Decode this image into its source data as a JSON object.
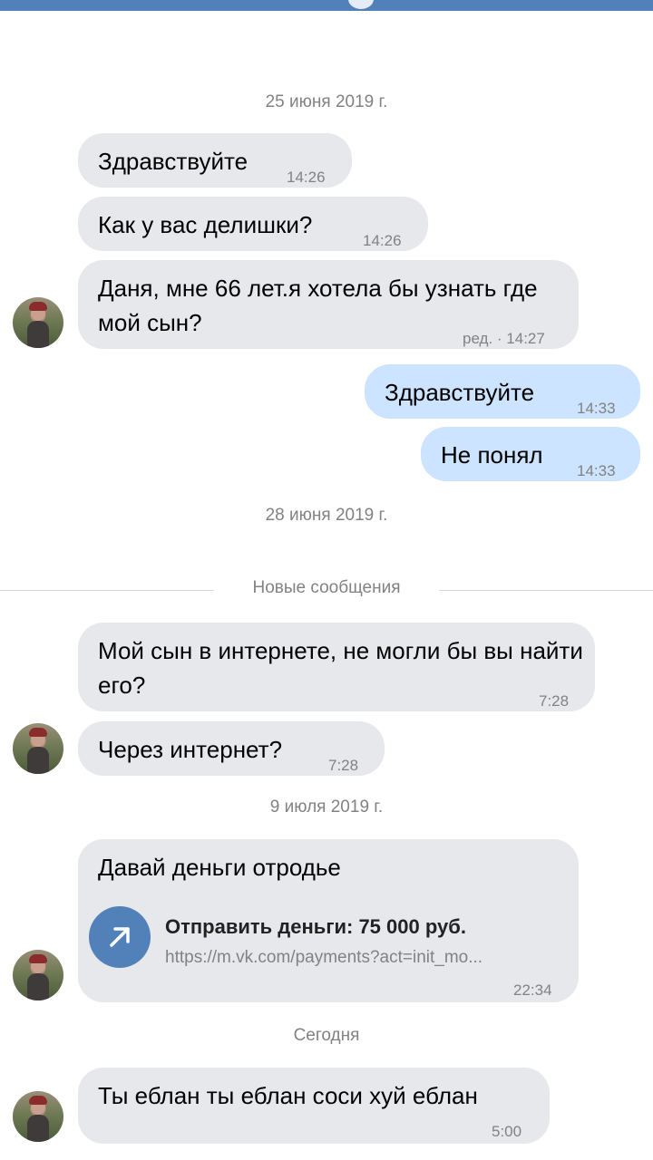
{
  "colors": {
    "accent": "#5181b8",
    "incoming_bubble": "#e7e8ec",
    "outgoing_bubble": "#cce4ff",
    "meta_text": "#828282"
  },
  "date_separators": {
    "d1": "25 июня 2019 г.",
    "d2": "28 июня 2019 г.",
    "d3": "9 июля 2019 г.",
    "d4": "Сегодня"
  },
  "new_messages_label": "Новые сообщения",
  "messages": {
    "m1": {
      "text": "Здравствуйте",
      "time": "14:26"
    },
    "m2": {
      "text": "Как у вас делишки?",
      "time": "14:26"
    },
    "m3": {
      "text": "Даня, мне 66 лет.я хотела бы узнать где мой сын?",
      "time": "ред. · 14:27"
    },
    "m4": {
      "text": "Здравствуйте",
      "time": "14:33"
    },
    "m5": {
      "text": "Не понял",
      "time": "14:33"
    },
    "m6": {
      "text": "Мой сын в интернете, не могли бы вы найти его?",
      "time": "7:28"
    },
    "m7": {
      "text": "Через интернет?",
      "time": "7:28"
    },
    "m8": {
      "text": "Давай деньги отродье",
      "time": "22:34",
      "link": {
        "icon": "arrow-up-right-icon",
        "title": "Отправить деньги: 75 000 руб.",
        "url": "https://m.vk.com/payments?act=init_mo..."
      }
    },
    "m9": {
      "text": "Ты еблан ты еблан соси хуй еблан",
      "time": "5:00"
    }
  }
}
